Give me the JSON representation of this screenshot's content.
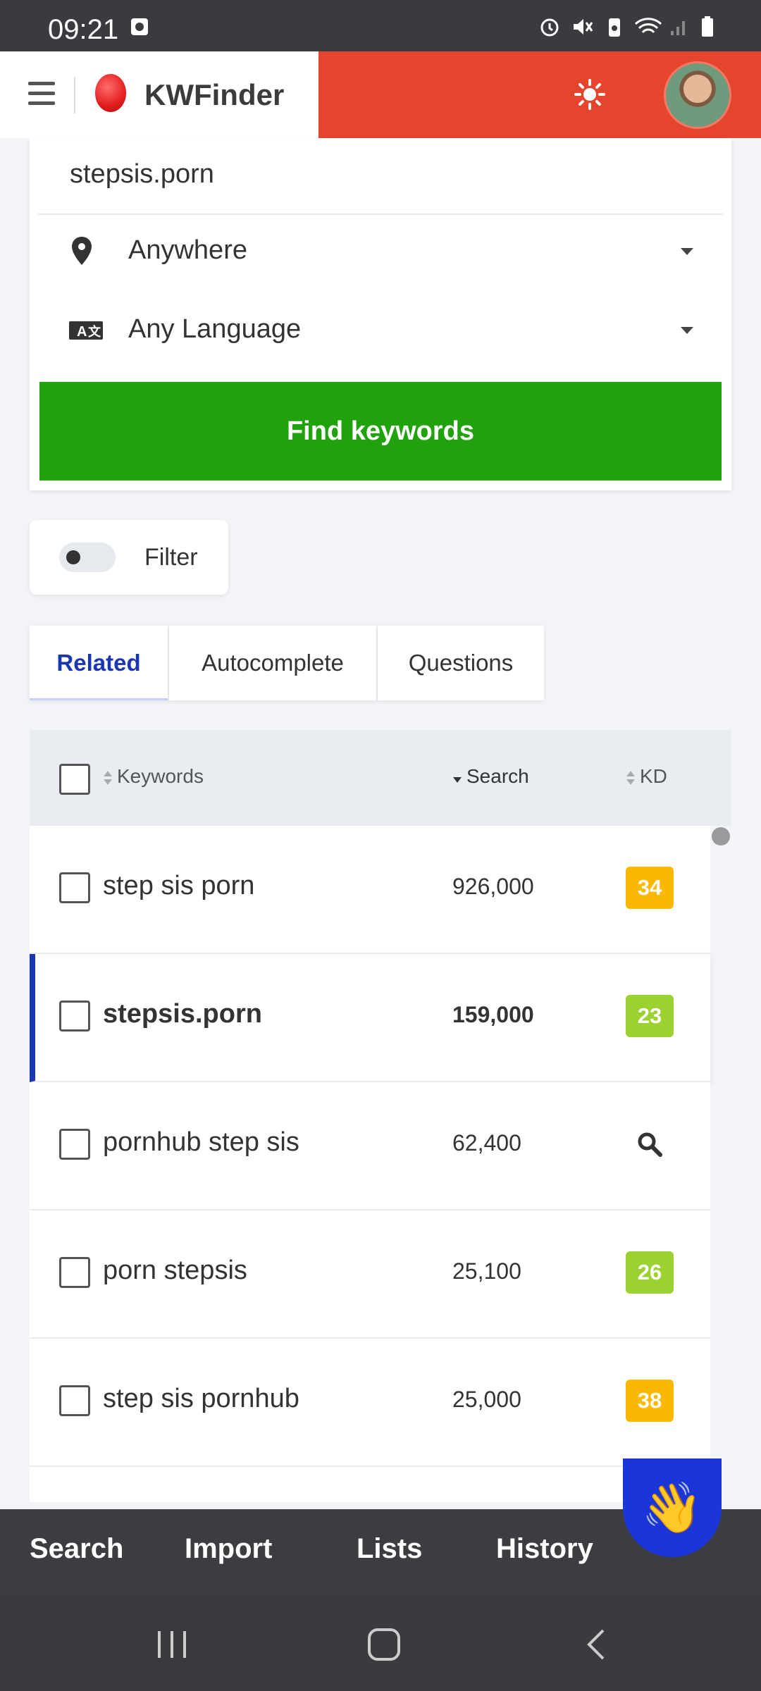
{
  "status_bar": {
    "time": "09:21"
  },
  "header": {
    "brand": "KWFinder",
    "accent_color": "#e5452c"
  },
  "search": {
    "query": "stepsis.porn",
    "location": "Anywhere",
    "language": "Any Language",
    "button_label": "Find keywords",
    "button_color": "#1fa20c"
  },
  "filter": {
    "label": "Filter"
  },
  "tabs": [
    {
      "label": "Related"
    },
    {
      "label": "Autocomplete"
    },
    {
      "label": "Questions"
    }
  ],
  "table": {
    "headers": {
      "keywords": "Keywords",
      "search": "Search",
      "kd": "KD"
    },
    "rows": [
      {
        "keyword": "step sis porn",
        "search": "926,000",
        "kd": "34",
        "kd_color": "#fbb800"
      },
      {
        "keyword": "stepsis.porn",
        "search": "159,000",
        "kd": "23",
        "kd_color": "#9bd22f"
      },
      {
        "keyword": "pornhub step sis",
        "search": "62,400",
        "kd": "",
        "kd_icon": "search-icon"
      },
      {
        "keyword": "porn stepsis",
        "search": "25,100",
        "kd": "26",
        "kd_color": "#9bd22f"
      },
      {
        "keyword": "step sis pornhub",
        "search": "25,000",
        "kd": "38",
        "kd_color": "#fbb800"
      }
    ]
  },
  "bottom_nav": {
    "search": "Search",
    "import": "Import",
    "lists": "Lists",
    "history": "History",
    "fab_icon": "👋"
  }
}
